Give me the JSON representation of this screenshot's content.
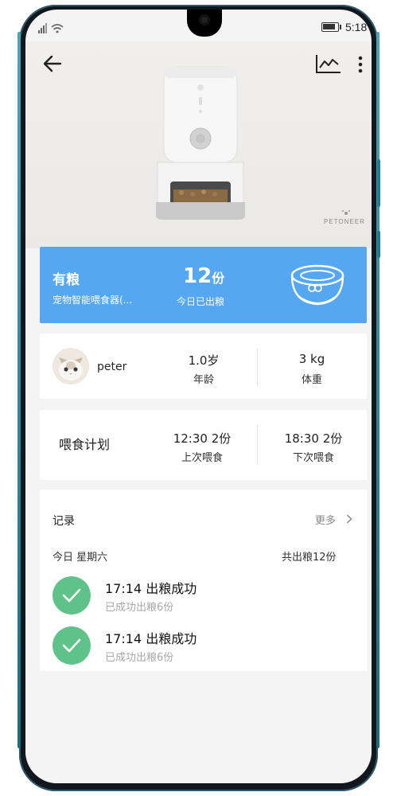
{
  "status": {
    "time": "5:18"
  },
  "hero": {
    "brand": "PETONEER"
  },
  "device": {
    "status": "有粮",
    "name": "宠物智能喂食器(...",
    "today_amount": "12",
    "today_unit": "份",
    "today_label": "今日已出粮"
  },
  "pet": {
    "name": "peter",
    "age_value": "1.0岁",
    "age_label": "年龄",
    "weight_value": "3 kg",
    "weight_label": "体重"
  },
  "plan": {
    "title": "喂食计划",
    "last_value": "12:30 2份",
    "last_label": "上次喂食",
    "next_value": "18:30 2份",
    "next_label": "下次喂食"
  },
  "records": {
    "title": "记录",
    "more_label": "更多",
    "day_label": "今日  星期六",
    "total_label": "共出粮12份",
    "items": [
      {
        "title": "17:14 出粮成功",
        "subtitle": "已成功出粮6份"
      },
      {
        "title": "17:14 出粮成功",
        "subtitle": "已成功出粮6份"
      }
    ]
  },
  "colors": {
    "accent_blue": "#55a7f1",
    "success_green": "#5fc389",
    "background": "#f4f4f4"
  },
  "icons": {
    "back": "arrow-left-icon",
    "stats": "line-chart-icon",
    "menu": "more-vertical-icon",
    "bowl": "bowl-icon",
    "check": "check-icon",
    "chevron": "chevron-right-icon"
  }
}
